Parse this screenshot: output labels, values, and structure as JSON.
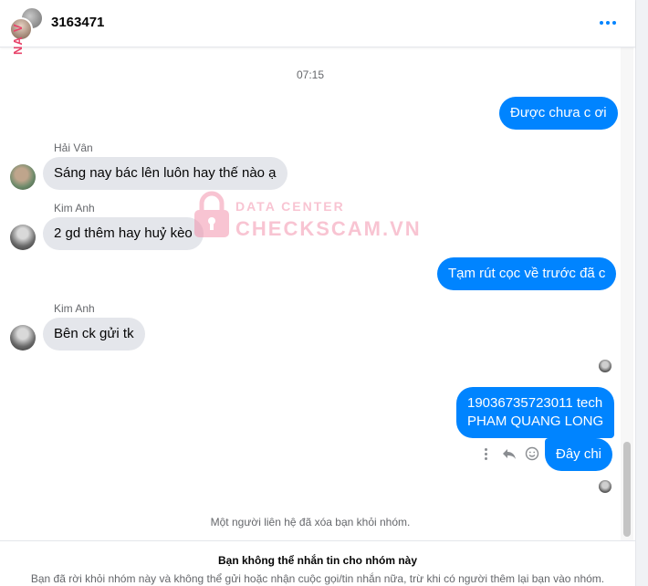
{
  "header": {
    "title": "3163471",
    "side_label": "NA V"
  },
  "timestamp": "07:15",
  "messages": {
    "m1": "Được chưa c ơi",
    "m2_sender": "Hải Vân",
    "m2": "Sáng nay bác lên luôn hay thế nào ạ",
    "m3_sender": "Kim Anh",
    "m3": "2 gd thêm hay huỷ kèo",
    "m4": "Tạm rút cọc về trước đã c",
    "m5_sender": "Kim Anh",
    "m5": "Bên ck gửi tk",
    "m6_line1": "19036735723011 tech",
    "m6_line2": "PHAM QUANG LONG",
    "m7": "Đây chi"
  },
  "watermark": {
    "top": "DATA CENTER",
    "main": "CHECKSCAM.VN"
  },
  "system_note": "Một người liên hệ đã xóa bạn khỏi nhóm.",
  "footer": {
    "title": "Bạn không thể nhắn tin cho nhóm này",
    "description": "Bạn đã rời khỏi nhóm này và không thể gửi hoặc nhận cuộc gọi/tin nhắn nữa, trừ khi có người thêm lại bạn vào nhóm."
  },
  "colors": {
    "outgoing_bubble": "#0084ff",
    "incoming_bubble": "#e4e6eb",
    "accent": "#0084ff"
  },
  "icons": [
    "more-options-icon",
    "more-vertical-icon",
    "reply-icon",
    "emoji-react-icon",
    "lock-icon"
  ]
}
